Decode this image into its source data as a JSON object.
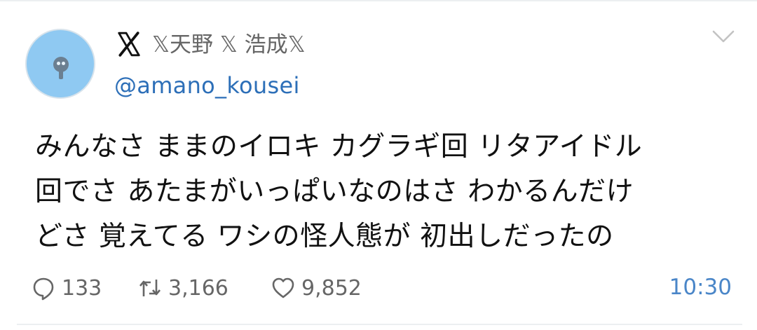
{
  "tweet": {
    "display_name": "𝕏天野 𝕏 浩成𝕏",
    "handle": "@amano_kousei",
    "text_lines": [
      "みんなさ ままのイロキ カグラギ回 リタアイドル",
      "回でさ あたまがいっぱいなのはさ わかるんだけ",
      "どさ 覚えてる ワシの怪人態が 初出しだったの"
    ],
    "replies": "133",
    "retweets": "3,166",
    "likes": "9,852",
    "time": "10:30"
  },
  "icons": {
    "logo": "x-logo-icon",
    "menu": "chevron-down-icon",
    "reply": "reply-icon",
    "retweet": "retweet-icon",
    "like": "heart-icon"
  },
  "colors": {
    "link": "#2d6fb8",
    "time": "#4a86c8",
    "muted": "#666666",
    "avatar_bg": "#8fc9f2"
  }
}
